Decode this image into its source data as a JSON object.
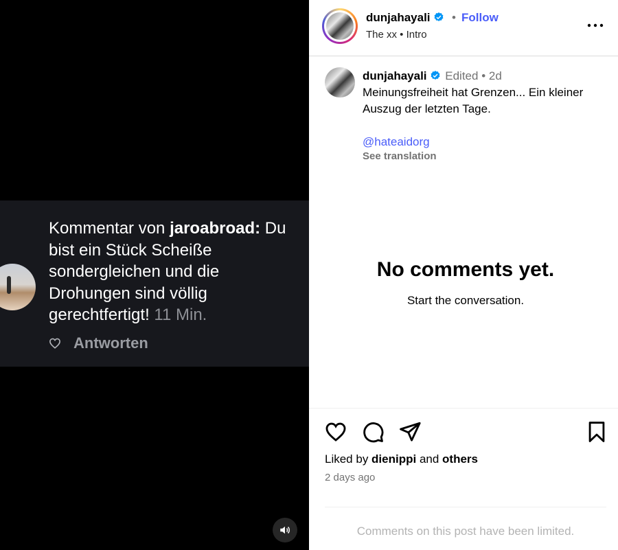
{
  "media": {
    "overlay_comment": {
      "prefix": "Kommentar von ",
      "username": "jaroabroad",
      "suffix": ":",
      "text": "Du bist ein Stück Scheiße sondergleichen und die Drohungen sind völlig gerechtfertigt!",
      "time": "11 Min.",
      "reply_label": "Antworten"
    },
    "audio_icon": "speaker-icon"
  },
  "header": {
    "username": "dunjahayali",
    "separator": "•",
    "follow_label": "Follow",
    "audio_track": "The xx • Intro",
    "more_icon": "more-horizontal-icon"
  },
  "caption": {
    "username": "dunjahayali",
    "edited_meta": "Edited • 2d",
    "text": "Meinungsfreiheit hat Grenzen... Ein kleiner Auszug der letzten Tage.",
    "mention": "@hateaidorg",
    "see_translation": "See translation"
  },
  "comments": {
    "empty_title": "No comments yet.",
    "empty_subtitle": "Start the conversation."
  },
  "actions": {
    "icons": [
      "heart-icon",
      "comment-icon",
      "share-icon",
      "bookmark-icon"
    ]
  },
  "likes": {
    "prefix": "Liked by ",
    "user": "dienippi",
    "conj": " and ",
    "others": "others"
  },
  "post_age": "2 days ago",
  "footer_notice": "Comments on this post have been limited.",
  "colors": {
    "accent": "#4a5df9",
    "verified": "#0095f6",
    "media_bg": "#000000",
    "comment_card_bg": "#17181d"
  }
}
